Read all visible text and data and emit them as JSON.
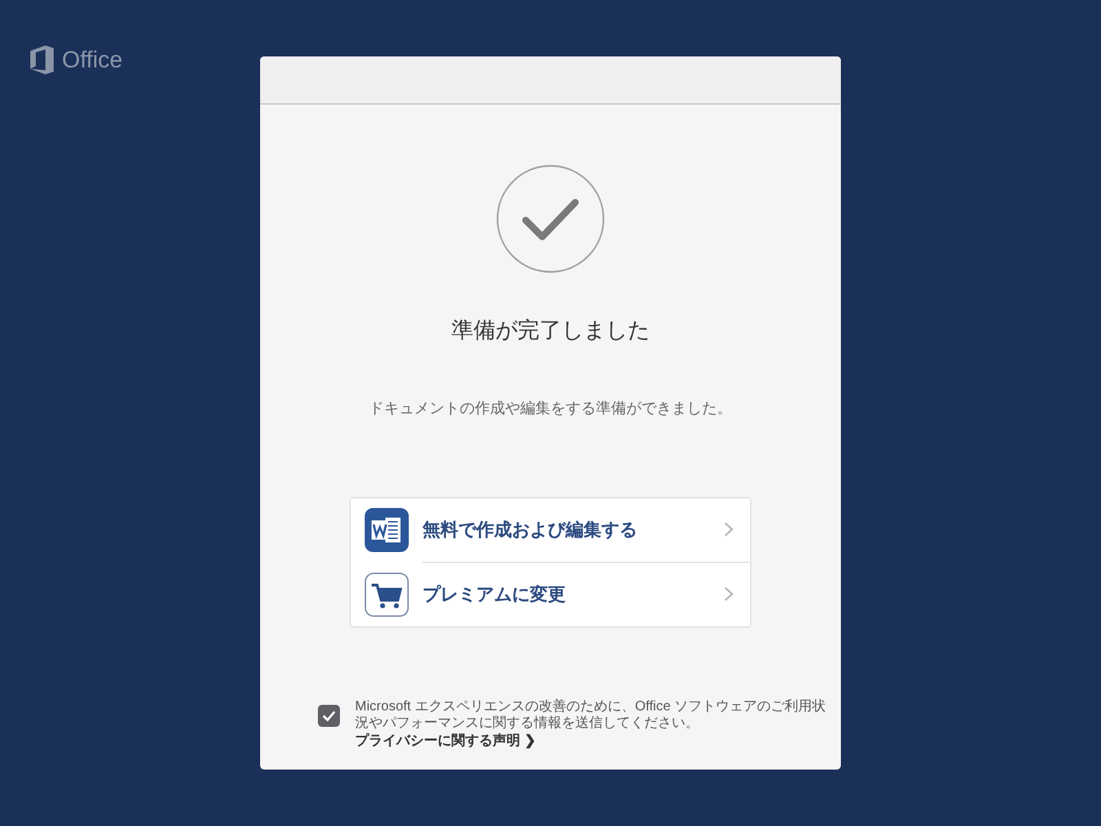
{
  "app_logo": {
    "text": "Office"
  },
  "dialog": {
    "title": "準備が完了しました",
    "message": "ドキュメントの作成や編集をする準備ができました。",
    "options": [
      {
        "kind": "word",
        "label": "無料で作成および編集する"
      },
      {
        "kind": "cart",
        "label": "プレミアムに変更"
      }
    ],
    "consent": {
      "checked": true,
      "text": "Microsoft エクスペリエンスの改善のために、Office ソフトウェアのご利用状況やパフォーマンスに関する情報を送信してください。",
      "link": "プライバシーに関する声明 ❯"
    }
  }
}
